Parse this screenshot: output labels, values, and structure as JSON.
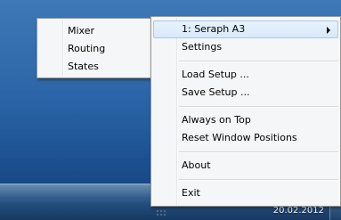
{
  "taskbar": {
    "date": "20.02.2012"
  },
  "submenu": {
    "items": [
      {
        "label": "Mixer"
      },
      {
        "label": "Routing"
      },
      {
        "label": "States"
      }
    ]
  },
  "main_menu": {
    "device_label": "1: Seraph A3",
    "settings_label": "Settings",
    "load_setup_label": "Load Setup ...",
    "save_setup_label": "Save Setup ...",
    "always_on_top_label": "Always on Top",
    "reset_window_positions_label": "Reset Window Positions",
    "about_label": "About",
    "exit_label": "Exit"
  },
  "icons": {
    "submenu_arrow": "chevron-right-icon"
  },
  "colors": {
    "menu_background": "#f5f6f7",
    "menu_border": "#979797",
    "selection_background": "#dbeaf9",
    "selection_border": "#a8c8e9",
    "desktop_blue": "#2b65a7",
    "taskbar": "#234e7e"
  }
}
